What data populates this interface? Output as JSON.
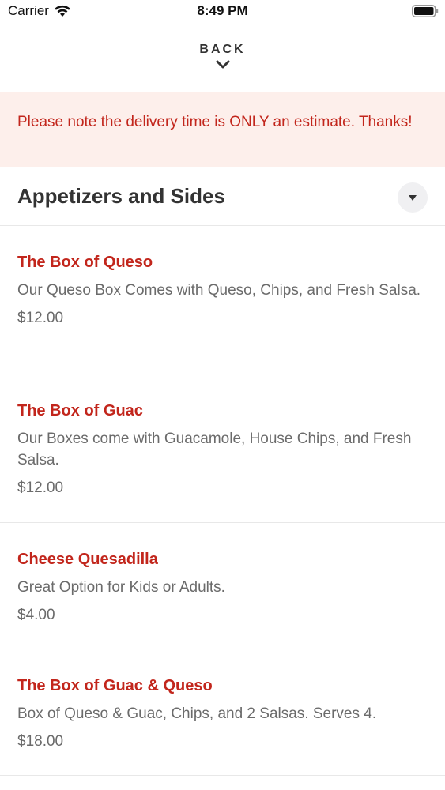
{
  "status_bar": {
    "carrier": "Carrier",
    "time": "8:49 PM"
  },
  "nav": {
    "back_label": "BACK"
  },
  "notice": {
    "text": "Please note the delivery time is ONLY an estimate. Thanks!"
  },
  "section": {
    "title": "Appetizers and Sides"
  },
  "menu_items": [
    {
      "name": "The Box of Queso",
      "description": "Our Queso Box Comes with Queso, Chips, and Fresh Salsa.",
      "price": "$12.00"
    },
    {
      "name": "The Box of Guac",
      "description": "Our Boxes come with Guacamole, House Chips, and Fresh Salsa.",
      "price": "$12.00"
    },
    {
      "name": "Cheese Quesadilla",
      "description": "Great Option for Kids or Adults.",
      "price": "$4.00"
    },
    {
      "name": "The Box of Guac & Queso",
      "description": "Box of Queso & Guac, Chips, and 2 Salsas.  Serves 4.",
      "price": "$18.00"
    }
  ],
  "colors": {
    "accent": "#c2261c",
    "notice_bg": "#fdefeb",
    "text_muted": "#6b6b6b"
  },
  "icons": {
    "wifi": "wifi-icon",
    "battery": "battery-icon",
    "back": "chevron-down-icon",
    "section_toggle": "caret-down-icon"
  }
}
